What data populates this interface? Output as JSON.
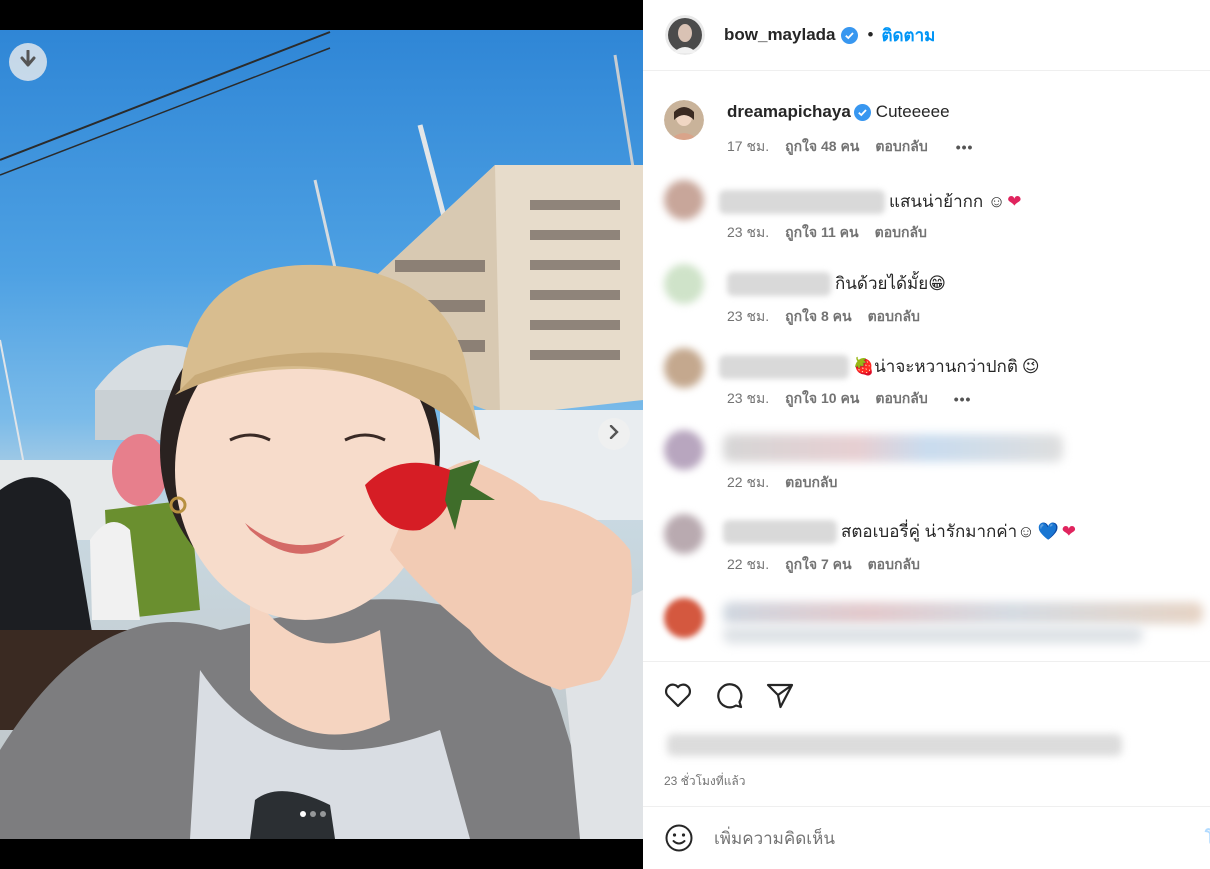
{
  "post": {
    "author": "bow_maylada",
    "follow_label": "ติดตาม",
    "separator": "•"
  },
  "comments": [
    {
      "user": "dreamapichaya",
      "verified": true,
      "text": "Cuteeeee",
      "time": "17 ชม.",
      "likes": "ถูกใจ 48 คน",
      "reply": "ตอบกลับ",
      "more": "•••"
    },
    {
      "user": "",
      "text": "แสนน่าย้ากก ☺",
      "emoji": [
        "❤"
      ],
      "time": "23 ชม.",
      "likes": "ถูกใจ 11 คน",
      "reply": "ตอบกลับ"
    },
    {
      "user": "",
      "text": "กินด้วยได้มั้ย",
      "emoji": [
        "😁"
      ],
      "time": "23 ชม.",
      "likes": "ถูกใจ 8 คน",
      "reply": "ตอบกลับ"
    },
    {
      "user": "",
      "emoji_before": "🍓",
      "text": "น่าจะหวานกว่าปกติ",
      "emoji": [
        "😉"
      ],
      "time": "23 ชม.",
      "likes": "ถูกใจ 10 คน",
      "reply": "ตอบกลับ",
      "more": "•••"
    },
    {
      "user": "",
      "text": "",
      "time": "22 ชม.",
      "reply": "ตอบกลับ"
    },
    {
      "user": "",
      "text": "สตอเบอรี่คู่ น่ารักมากค่า☺",
      "emoji": [
        "💙",
        "❤"
      ],
      "time": "22 ชม.",
      "likes": "ถูกใจ 7 คน",
      "reply": "ตอบกลับ"
    }
  ],
  "footer": {
    "time_ago": "23 ชั่วโมงที่แล้ว",
    "add_comment_placeholder": "เพิ่มความคิดเห็น",
    "post_label": "โ"
  },
  "icons": {
    "download": "download-icon",
    "next": "chevron-right-icon",
    "like": "heart-icon",
    "comment": "comment-icon",
    "share": "paper-plane-icon",
    "emoji": "smiley-icon",
    "verified": "verified-badge-icon"
  },
  "colors": {
    "accent": "#0095f6",
    "verified": "#3897f0",
    "muted": "#737373",
    "text": "#262626"
  },
  "carousel": {
    "count": 3,
    "active_index": 0
  }
}
